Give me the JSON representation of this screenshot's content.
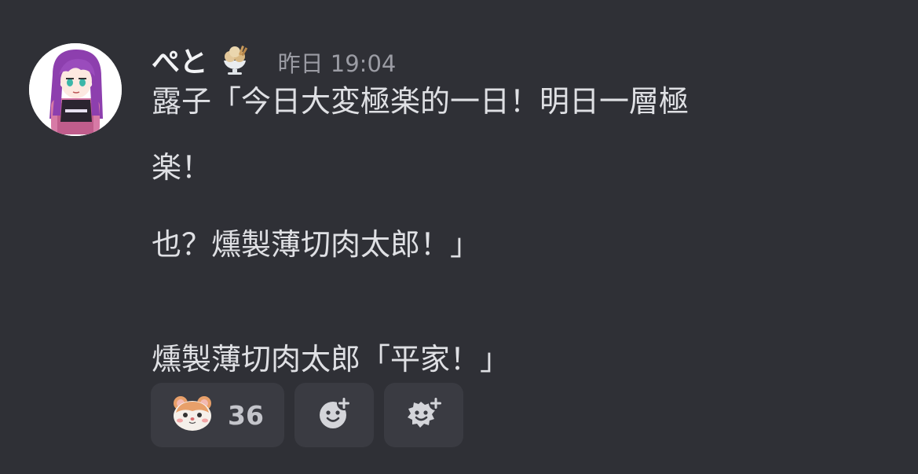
{
  "message": {
    "username": "ぺと",
    "badge_icon": "ice-cream-sundae-icon",
    "timestamp": "昨日 19:04",
    "lines": [
      "露子「今日大変極楽的一日！明日一層極",
      "楽！",
      "也？燻製薄切肉太郎！」",
      "燻製薄切肉太郎「平家！」"
    ]
  },
  "reactions": [
    {
      "icon": "hamster-face-icon",
      "count": "36"
    },
    {
      "icon": "add-reaction-icon"
    },
    {
      "icon": "add-super-reaction-icon"
    }
  ],
  "colors": {
    "background": "#2f3036",
    "text": "#dfe0e4",
    "username": "#f2f3f5",
    "timestamp": "#9b9ca4",
    "reaction_bg": "#3a3b42"
  }
}
